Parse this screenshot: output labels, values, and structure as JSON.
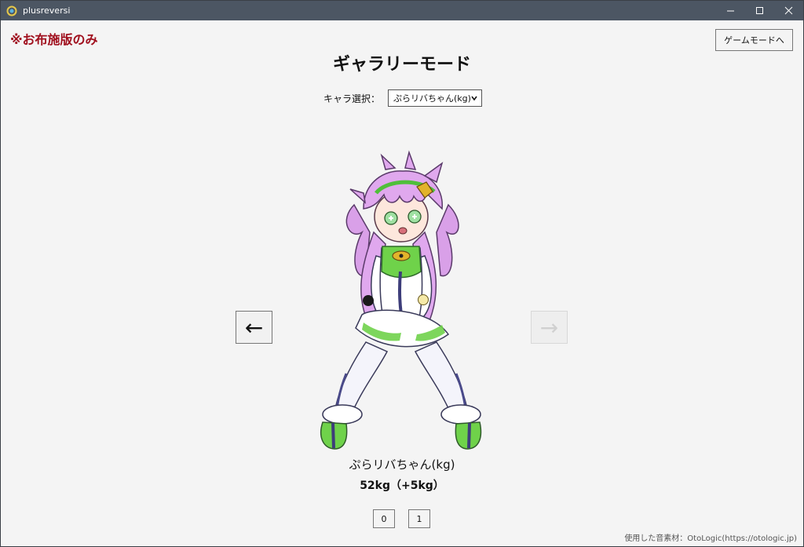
{
  "window": {
    "title": "plusreversi"
  },
  "note": "※お布施版のみ",
  "header": {
    "game_mode_button": "ゲームモードへ",
    "title": "ギャラリーモード"
  },
  "selector": {
    "label": "キャラ選択：",
    "selected": "ぷらリバちゃん(kg)"
  },
  "nav": {
    "prev": "←",
    "next": "→",
    "next_enabled": false
  },
  "character": {
    "name": "ぷらリバちゃん(kg)",
    "weight": "52kg（+5kg）"
  },
  "image_buttons": [
    "0",
    "1"
  ],
  "credit": "使用した音素材：OtoLogic(https://otologic.jp)",
  "colors": {
    "titlebar": "#4c5663",
    "note": "#a0101e",
    "background": "#f4f4f4"
  }
}
